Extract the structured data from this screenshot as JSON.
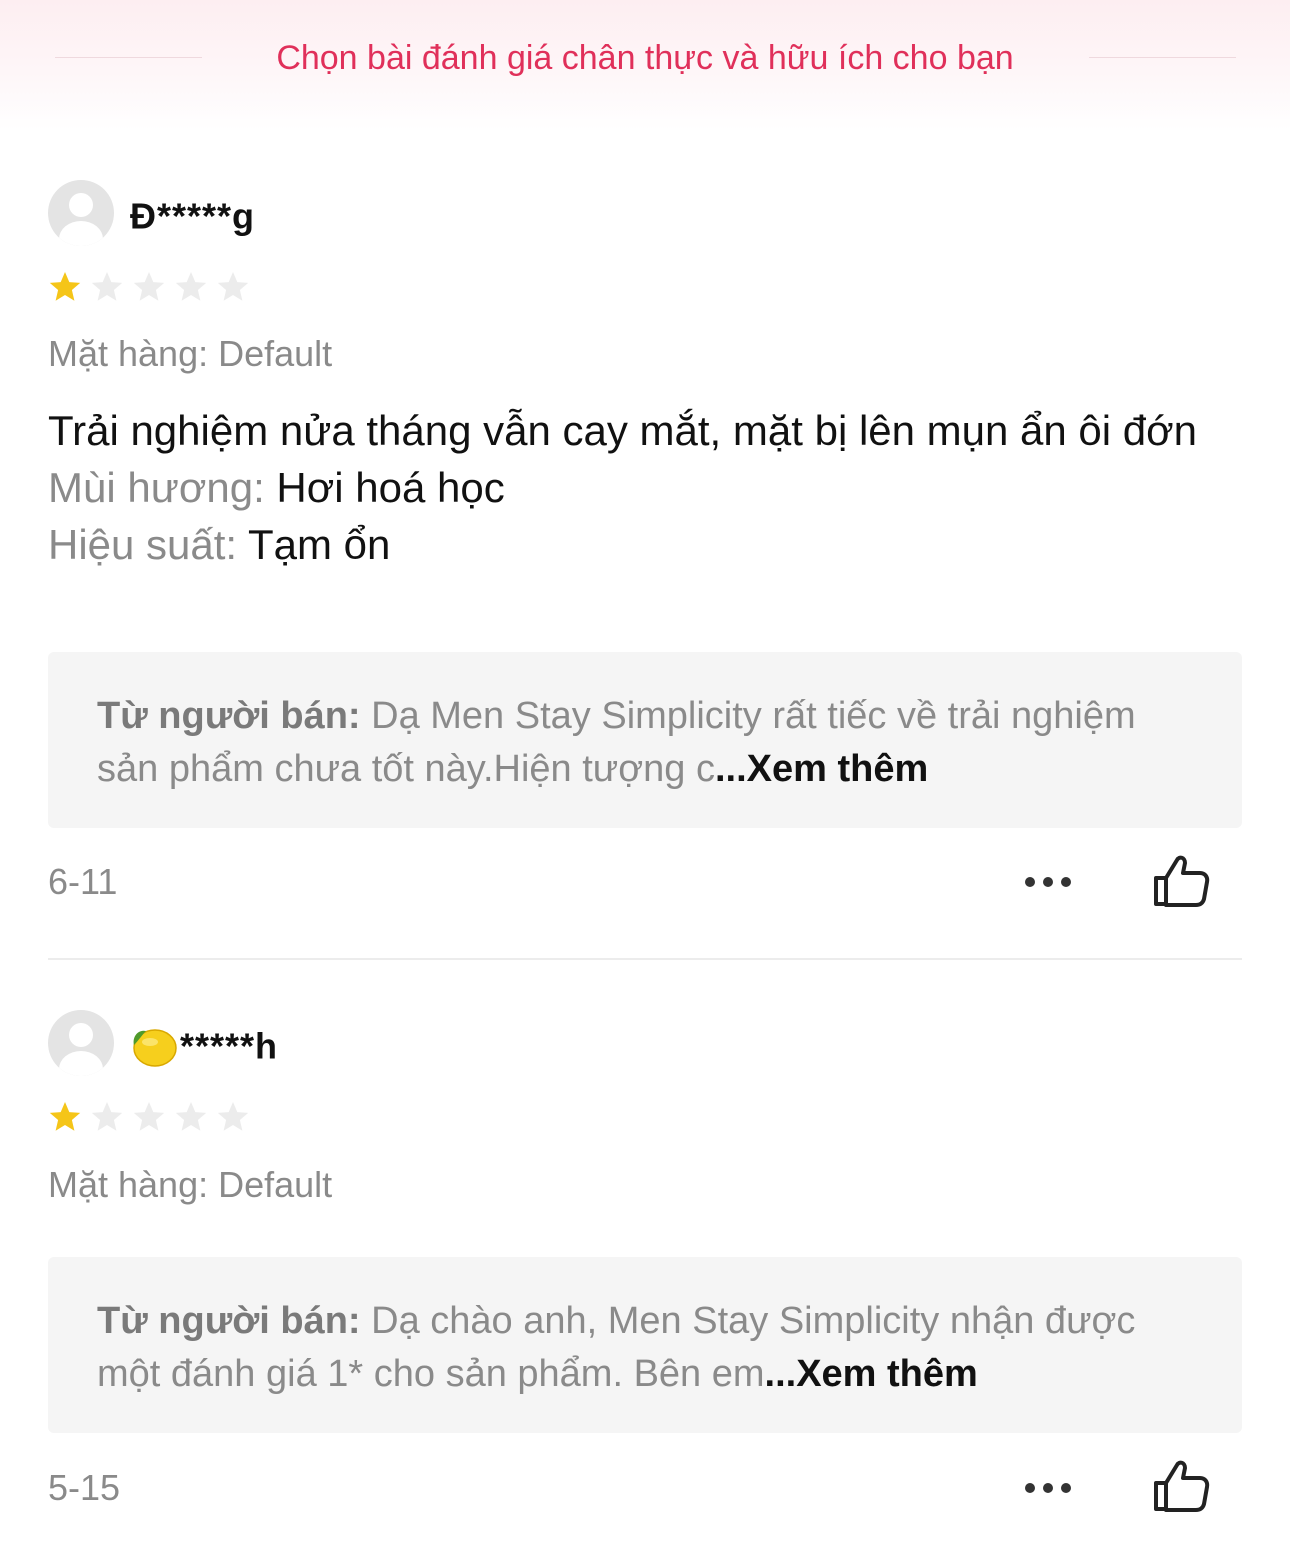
{
  "header": {
    "title": "Chọn bài đánh giá chân thực và hữu ích cho bạn"
  },
  "reviews": [
    {
      "username": "Đ*****g",
      "username_emoji": "",
      "rating": 1,
      "max_rating": 5,
      "variant": "Mặt hàng: Default",
      "content_text": "Trải nghiệm nửa tháng vẫn cay mắt, mặt bị lên mụn ẩn ôi đớn",
      "attributes": [
        {
          "label": "Mùi hương: ",
          "value": "Hơi hoá học"
        },
        {
          "label": "Hiệu suất: ",
          "value": "Tạm ổn"
        }
      ],
      "seller_label": "Từ người bán:",
      "seller_text": " Dạ Men Stay Simplicity rất tiếc về trải nghiệm sản phẩm chưa tốt này.Hiện tượng c",
      "seller_more": "...Xem thêm",
      "date": "6-11"
    },
    {
      "username": "*****h",
      "username_emoji": "🍋",
      "rating": 1,
      "max_rating": 5,
      "variant": "Mặt hàng: Default",
      "seller_label": "Từ người bán:",
      "seller_text": " Dạ chào anh, Men Stay Simplicity nhận được một đánh giá 1* cho sản phẩm. Bên em",
      "seller_more": "...Xem thêm",
      "date": "5-15"
    }
  ],
  "colors": {
    "accent": "#e0305a",
    "star_filled": "#f5c518",
    "star_empty": "#ececec",
    "muted_text": "#8a8a8a"
  },
  "icons": {
    "avatar": "default-avatar-icon",
    "star": "star-icon",
    "more": "more-dots-icon",
    "like": "thumbs-up-icon",
    "emoji": "lemon-emoji"
  }
}
